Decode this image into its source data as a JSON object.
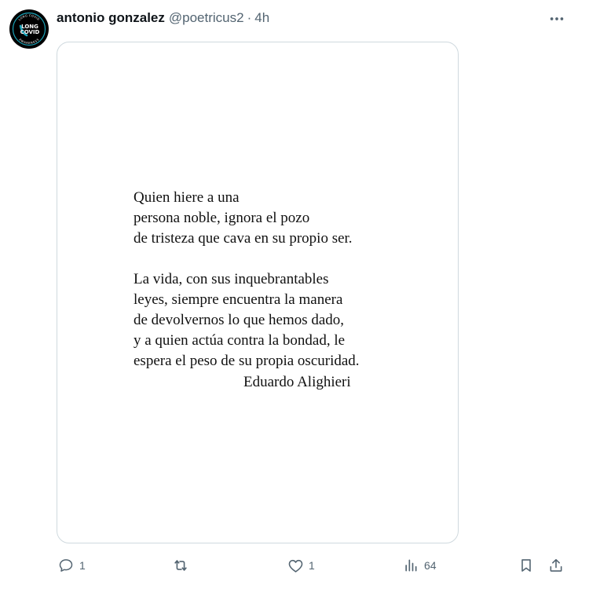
{
  "tweet": {
    "author": {
      "name": "antonio gonzalez",
      "handle": "@poetricus2",
      "separator": "·",
      "time": "4h",
      "avatar": {
        "icon": "long-covid-awareness-badge",
        "text_top": "LONG COVID",
        "line1": "LONG",
        "line2": "COVID",
        "text_bottom": "AWARENESS"
      }
    },
    "media": {
      "poem": {
        "stanza1": [
          "Quien hiere a una",
          "persona noble, ignora el pozo",
          "de tristeza que cava en su propio ser."
        ],
        "stanza2": [
          "La vida, con sus inquebrantables",
          "leyes, siempre encuentra la manera",
          "de devolvernos lo que hemos dado,",
          "y a quien actúa contra la bondad, le",
          "espera el peso de su propia oscuridad."
        ],
        "signature": "Eduardo Alighieri"
      }
    },
    "actions": {
      "reply": {
        "icon": "reply-icon",
        "count": "1"
      },
      "repost": {
        "icon": "repost-icon",
        "count": ""
      },
      "like": {
        "icon": "heart-icon",
        "count": "1"
      },
      "views": {
        "icon": "views-icon",
        "count": "64"
      },
      "bookmark": {
        "icon": "bookmark-icon"
      },
      "share": {
        "icon": "share-icon"
      }
    }
  },
  "colors": {
    "text_primary": "#0f1419",
    "text_secondary": "#536471",
    "border": "#cfd9de",
    "avatar_accent": "#1aa3b8"
  }
}
